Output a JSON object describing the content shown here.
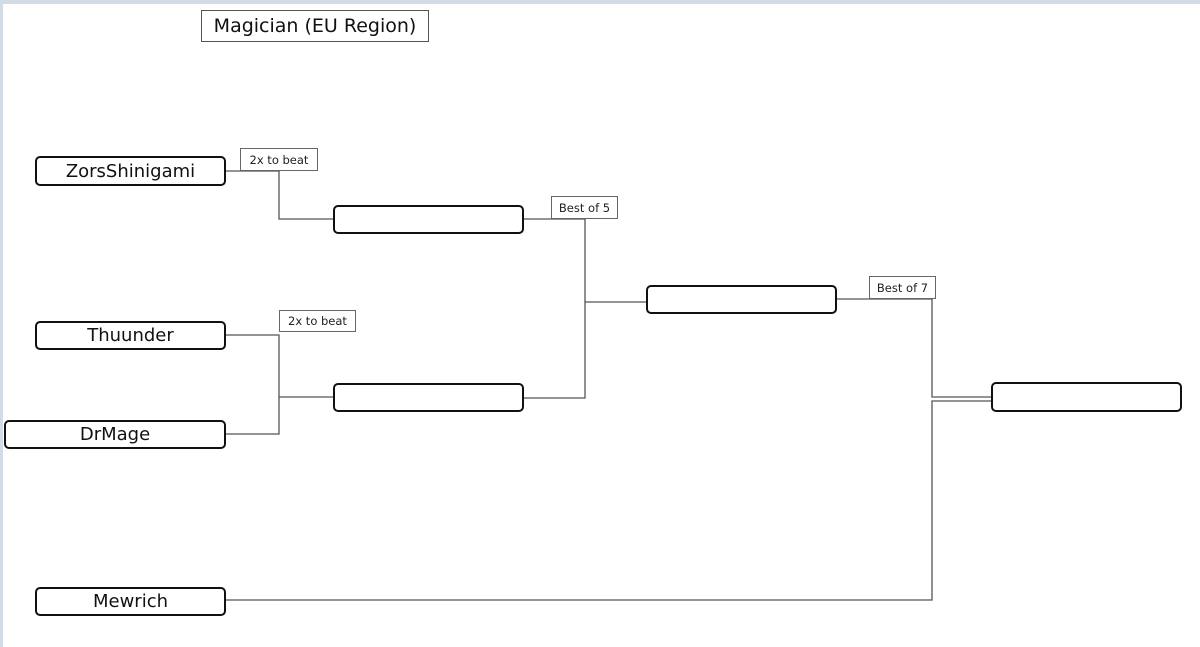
{
  "title": "Magician (EU Region)",
  "players": [
    "ZorsShinigami",
    "Thuunder",
    "DrMage",
    "Mewrich"
  ],
  "match_labels": {
    "round1_top": "2x to beat",
    "round1_bottom": "2x to beat",
    "semifinal": "Best of 5",
    "final": "Best of 7"
  },
  "winner_slots": {
    "round2_top": "",
    "round2_bottom": "",
    "round3": "",
    "champion": ""
  }
}
